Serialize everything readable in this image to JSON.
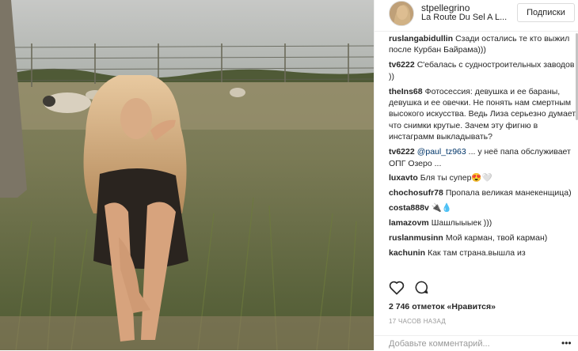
{
  "post": {
    "username": "stpellegrino",
    "location": "La Route Du Sel A L...",
    "follow_label": "Подписки",
    "likes": "2 746 отметок «Нравится»",
    "time": "17 часов назад",
    "add_comment_placeholder": "Добавьте комментарий...",
    "more_icon": "more-dots-icon",
    "like_icon": "heart-icon",
    "comment_icon": "speech-bubble-icon"
  },
  "comments": [
    {
      "user": "ruslangabidullin",
      "text": "Сзади остались те кто выжил после Курбан Байрама)))"
    },
    {
      "user": "tv6222",
      "text": "С'ебалась с судностроительных заводов ))"
    },
    {
      "user": "theIns68",
      "text": "Фотосессия: девушка и ее бараны, девушка и ее овечки. Не понять нам смертным высокого искусства. Ведь Лиза серьезно думает, что снимки крутые. Зачем эту фигню в инстаграмм выкладывать?"
    },
    {
      "user": "tv6222",
      "mention": "@paul_tz963",
      "text": "... у неё папа обслуживает ОПГ Озеро ..."
    },
    {
      "user": "luxavto",
      "text": "Бля ты супер😍🤍"
    },
    {
      "user": "chochosufr78",
      "text": "Пропала великая манекенщица)"
    },
    {
      "user": "costa888v",
      "text": "🔌💧"
    },
    {
      "user": "lamazovm",
      "text": "Шашлыыыек )))"
    },
    {
      "user": "ruslanmusinn",
      "text": "Мой карман, твой карман)"
    },
    {
      "user": "kachunin",
      "text": "Как там страна.вышла из"
    }
  ],
  "colors": {
    "text": "#262626",
    "muted": "#999999",
    "border": "#efefef",
    "mention": "#003569"
  }
}
